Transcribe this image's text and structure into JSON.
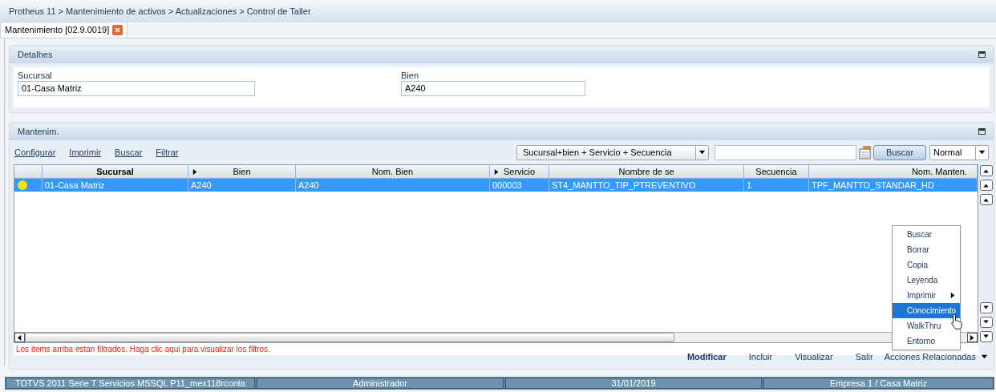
{
  "breadcrumb": "Protheus 11 > Mantenimiento de activos > Actualizaciones > Control de Taller",
  "tabs": [
    {
      "label": "Mantenimiento [02.9.0019]",
      "selected": true
    }
  ],
  "details": {
    "title": "Detalhes",
    "fields": [
      {
        "label": "Sucursal",
        "value": "01-Casa Matriz"
      },
      {
        "label": "Bien",
        "value": "A240"
      }
    ]
  },
  "grid_panel": {
    "title": "Mantenim.",
    "toolbar_links": [
      "Configurar",
      "Imprimir",
      "Buscar",
      "Filtrar"
    ],
    "index_select": "Sucursal+bien + Servicio + Secuencia",
    "search_button": "Buscar",
    "view_select": "Normal",
    "columns": [
      {
        "label": "Sucursal",
        "marker": false,
        "bold": true
      },
      {
        "label": "Bien",
        "marker": true,
        "bold": false
      },
      {
        "label": "Nom. Bien",
        "marker": false,
        "bold": false
      },
      {
        "label": "Servicio",
        "marker": true,
        "bold": false
      },
      {
        "label": "Nombre de se",
        "marker": false,
        "bold": false
      },
      {
        "label": "Secuencia",
        "marker": false,
        "bold": false
      },
      {
        "label": "Nom. Manten.",
        "marker": false,
        "bold": false
      }
    ],
    "rows": [
      {
        "selected": true,
        "color": "#f2e600",
        "cells": [
          "01-Casa Matriz",
          "A240",
          "A240",
          "000003",
          "ST4_MANTTO_TIP_PTREVENTIVO",
          "1",
          "TPF_MANTTO_STANDAR_HD"
        ]
      }
    ],
    "filter_notice": "Los items arriba estan filtrados. Haga clic aqui para visualizar los filtros."
  },
  "context_menu": [
    {
      "label": "Buscar",
      "selected": false,
      "submenu": false
    },
    {
      "label": "Borrar",
      "selected": false,
      "submenu": false
    },
    {
      "label": "Copia",
      "selected": false,
      "submenu": false
    },
    {
      "label": "Leyenda",
      "selected": false,
      "submenu": false
    },
    {
      "label": "Imprimir",
      "selected": false,
      "submenu": true
    },
    {
      "label": "Conocimiento",
      "selected": true,
      "submenu": false
    },
    {
      "label": "WalkThru",
      "selected": false,
      "submenu": false
    },
    {
      "label": "Entorno",
      "selected": false,
      "submenu": false
    }
  ],
  "actions": [
    {
      "label": "Modificar",
      "primary": true
    },
    {
      "label": "Incluir",
      "primary": false
    },
    {
      "label": "Visualizar",
      "primary": false
    },
    {
      "label": "Salir",
      "primary": false
    }
  ],
  "related_actions": "Acciones Relacionadas",
  "status_bar": [
    "TOTVS 2011 Serie T Servicios MSSQL P11_mex118rconta",
    "Administrador",
    "31/01/2019",
    "Empresa 1 / Casa Matriz"
  ]
}
